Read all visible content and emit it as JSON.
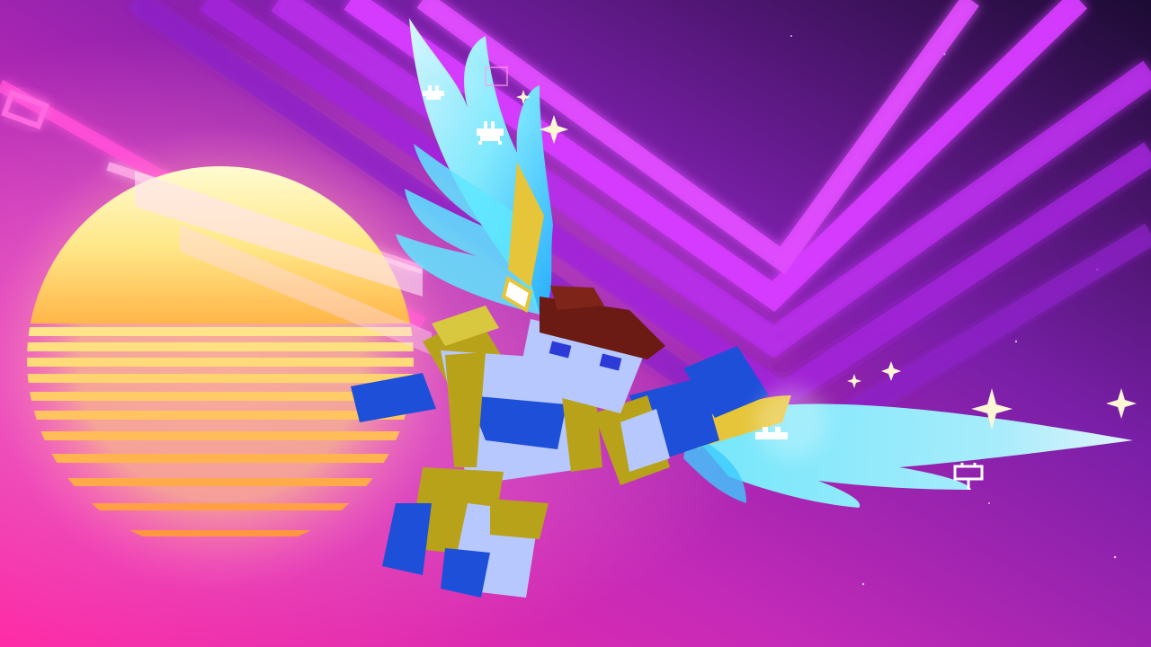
{
  "scene": {
    "type": "game-screenshot",
    "hud_text": "",
    "elements": {
      "sky": "synthwave-night-sky",
      "sun": "striped-retro-sun",
      "neon_lines": "magenta-neon-chevrons",
      "character": "voxel-winged-hero",
      "wings": "cyan-crystal-wings",
      "sparkles": "twinkle-stars",
      "pixel_icons": "pixel-invader-glyphs"
    }
  },
  "colors": {
    "sky_top_right": "#1c0b33",
    "sky_mid": "#7a1fa8",
    "sky_bottom_left": "#ff2aa5",
    "sun_top": "#fff7b0",
    "sun_bottom": "#ffb648",
    "neon_magenta": "#d63cff",
    "neon_pink": "#ff4fd8",
    "wing_cyan": "#7ff3ff",
    "wing_blue": "#1fb4ff",
    "armor_gold": "#b7a21a",
    "armor_blue": "#1e4fd8",
    "skin_blue": "#b7c8ff",
    "hair_brown": "#6b1a14",
    "sparkle": "#fff6d6"
  }
}
